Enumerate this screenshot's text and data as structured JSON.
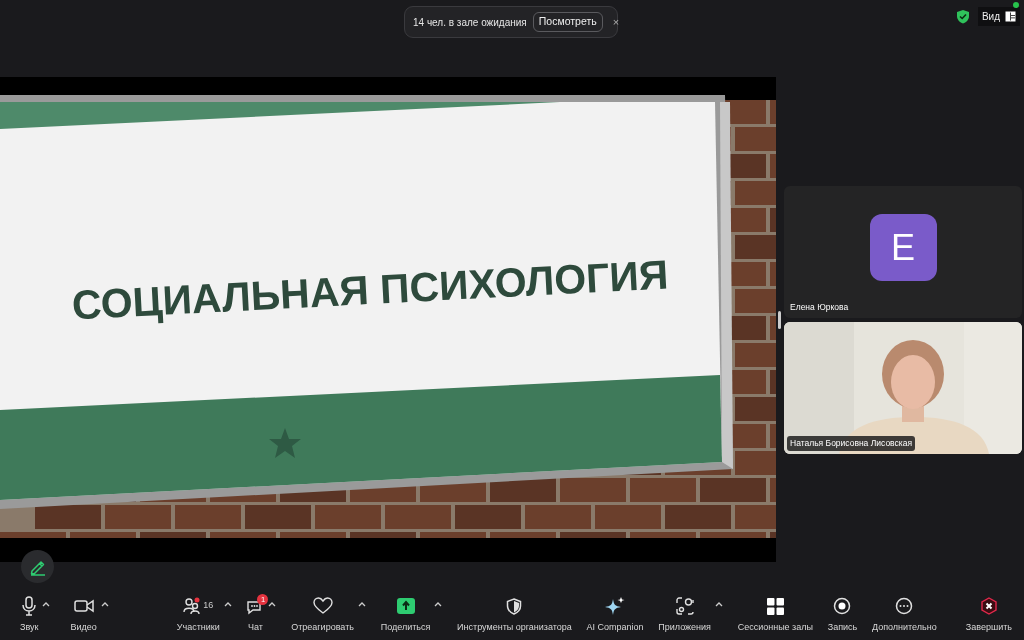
{
  "notification": {
    "text": "14 чел. в зале ожидания",
    "button": "Посмотреть",
    "close": "×"
  },
  "top_right": {
    "view_label": "Вид"
  },
  "slide": {
    "title": "СОЦИАЛЬНАЯ ПСИХОЛОГИЯ"
  },
  "participants": [
    {
      "name": "Елена Юркова",
      "kind": "avatar",
      "initial": "E"
    },
    {
      "name": "Наталья Борисовна Лисовская",
      "kind": "picture"
    }
  ],
  "toolbar": [
    {
      "label": "Звук",
      "caret": true
    },
    {
      "label": "Видео",
      "caret": true
    },
    {
      "label": "Участники",
      "count": "16",
      "caret": true
    },
    {
      "label": "Чат",
      "badge": "1",
      "caret": true
    },
    {
      "label": "Отреагировать",
      "caret": true
    },
    {
      "label": "Поделиться",
      "caret": true
    },
    {
      "label": "Инструменты организатора",
      "caret": false
    },
    {
      "label": "AI Companion",
      "caret": false
    },
    {
      "label": "Приложения",
      "caret": true
    },
    {
      "label": "Сессионные залы",
      "caret": false
    },
    {
      "label": "Запись",
      "caret": false
    },
    {
      "label": "Дополнительно",
      "caret": false
    },
    {
      "label": "Завершить",
      "caret": false
    }
  ]
}
